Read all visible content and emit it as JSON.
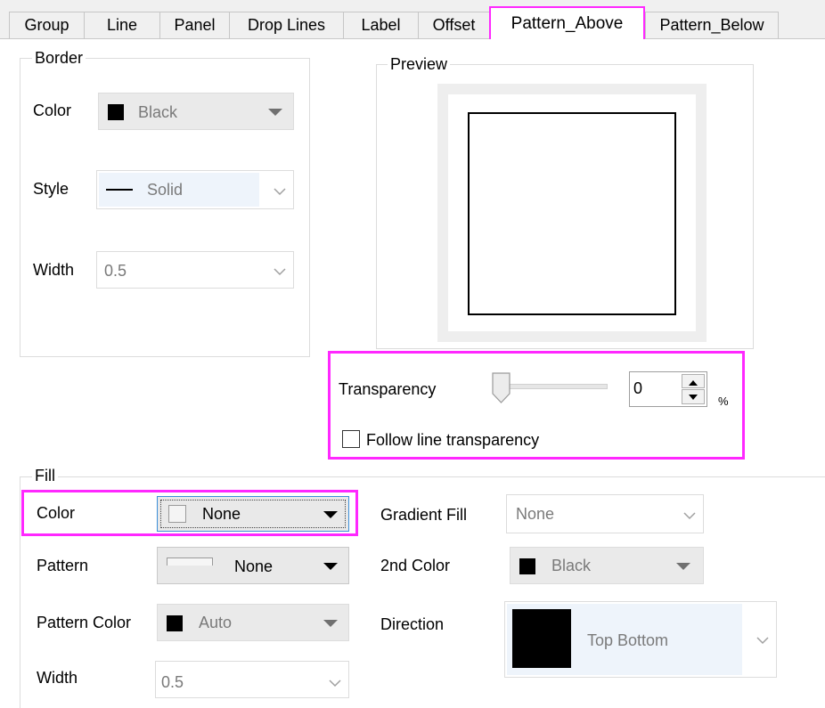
{
  "tabs": [
    {
      "label": "Group"
    },
    {
      "label": "Line"
    },
    {
      "label": "Panel"
    },
    {
      "label": "Drop Lines"
    },
    {
      "label": "Label"
    },
    {
      "label": "Offset"
    },
    {
      "label": "Pattern_Above",
      "active": true
    },
    {
      "label": "Pattern_Below"
    }
  ],
  "border": {
    "legend": "Border",
    "color_label": "Color",
    "color_value": "Black",
    "style_label": "Style",
    "style_value": "Solid",
    "width_label": "Width",
    "width_value": "0.5"
  },
  "preview": {
    "legend": "Preview"
  },
  "transparency": {
    "label": "Transparency",
    "value": "0",
    "unit": "%",
    "slider_fraction": 0,
    "follow_label": "Follow line transparency",
    "follow_checked": false
  },
  "fill": {
    "legend": "Fill",
    "color_label": "Color",
    "color_value": "None",
    "pattern_label": "Pattern",
    "pattern_value": "None",
    "pattern_color_label": "Pattern Color",
    "pattern_color_value": "Auto",
    "width_label": "Width",
    "width_value": "0.5",
    "gradient_label": "Gradient Fill",
    "gradient_value": "None",
    "second_color_label": "2nd Color",
    "second_color_value": "Black",
    "direction_label": "Direction",
    "direction_value": "Top Bottom"
  },
  "colors": {
    "highlight": "#ff28ff",
    "disabled_bg": "#eaeaea",
    "group_border": "#dcdcdc"
  }
}
